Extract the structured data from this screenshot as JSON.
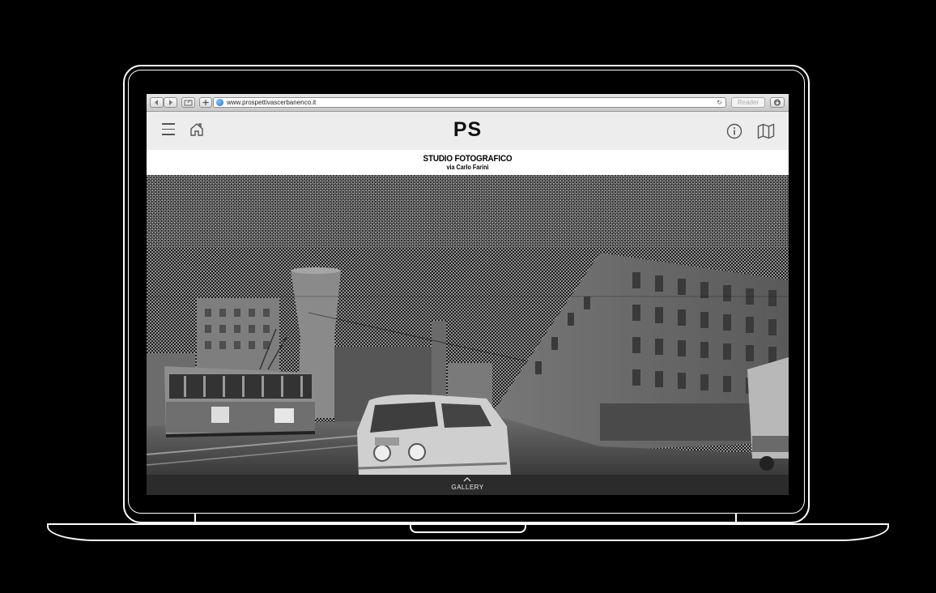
{
  "browser": {
    "url": "www.prospettivascerbanenco.it",
    "reader_label": "Reader"
  },
  "site": {
    "logo": "PS"
  },
  "location": {
    "title": "STUDIO FOTOGRAFICO",
    "subtitle": "via Carlo Farini"
  },
  "footer": {
    "gallery_label": "GALLERY"
  },
  "icons": {
    "back": "chevron-left-icon",
    "forward": "chevron-right-icon",
    "share": "share-icon",
    "add": "plus-icon",
    "globe": "globe-icon",
    "reload": "reload-icon",
    "download": "download-icon",
    "menu": "hamburger-menu-icon",
    "home": "home-icon",
    "info": "info-icon",
    "map": "map-icon",
    "caret": "chevron-up-icon"
  }
}
